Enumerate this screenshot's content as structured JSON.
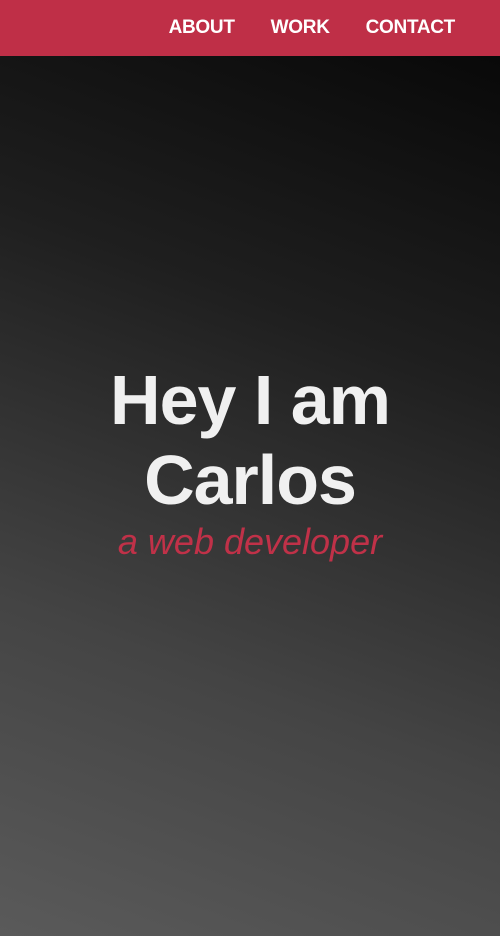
{
  "nav": {
    "items": [
      {
        "label": "ABOUT"
      },
      {
        "label": "WORK"
      },
      {
        "label": "CONTACT"
      }
    ]
  },
  "hero": {
    "line1": "Hey I am",
    "line2": "Carlos",
    "subtitle": "a web developer"
  },
  "colors": {
    "accent": "#bf2f47",
    "title": "#f0f0f0",
    "subtitle": "#c03148",
    "background_top": "#050505",
    "background_bottom": "#5a5a5a"
  }
}
